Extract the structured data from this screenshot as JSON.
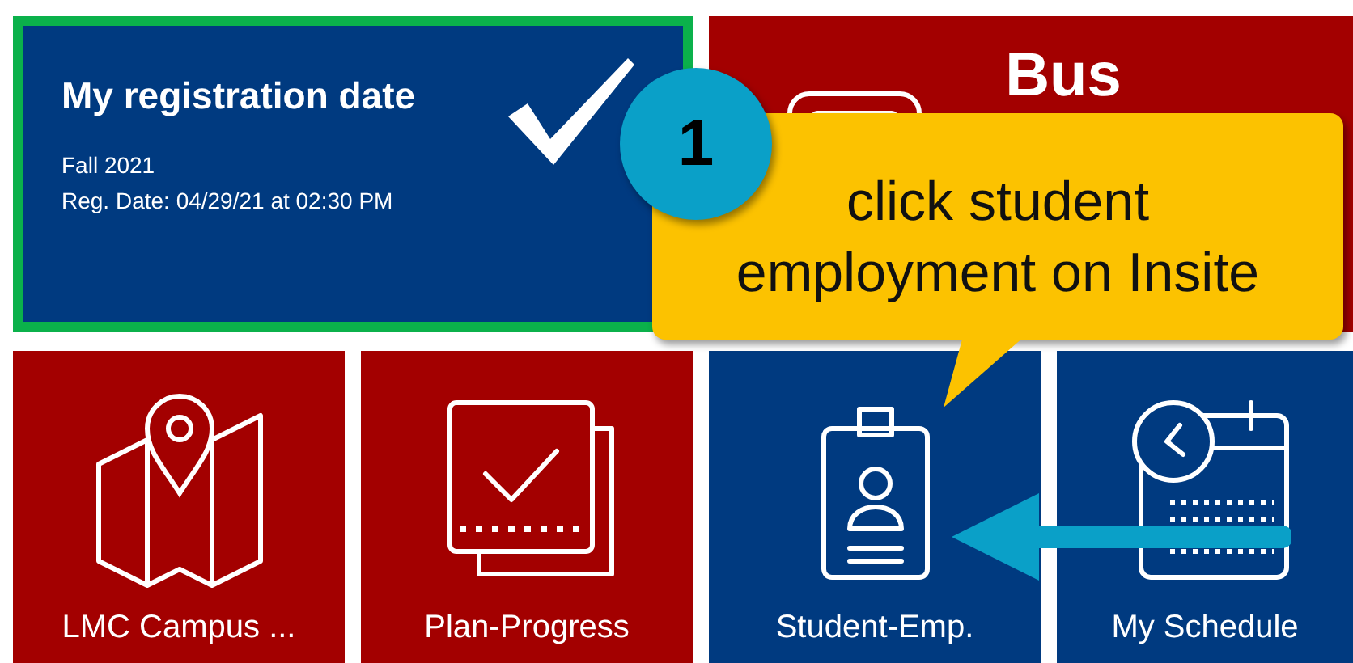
{
  "registration_tile": {
    "title": "My registration date",
    "term": "Fall 2021",
    "reg_date": "Reg. Date: 04/29/21 at 02:30 PM",
    "completed": true,
    "color": "#003a80"
  },
  "bus_tile": {
    "title": "Bus",
    "color": "#a30000"
  },
  "tiles": [
    {
      "label": "LMC Campus ...",
      "kind": "map",
      "color": "#a30000"
    },
    {
      "label": "Plan-Progress",
      "kind": "progress",
      "color": "#a30000"
    },
    {
      "label": "Student-Emp.",
      "kind": "badge",
      "color": "#003a80"
    },
    {
      "label": "My Schedule",
      "kind": "calendar",
      "color": "#003a80"
    }
  ],
  "callout": {
    "step": "1",
    "text": "click student employment on Insite"
  }
}
